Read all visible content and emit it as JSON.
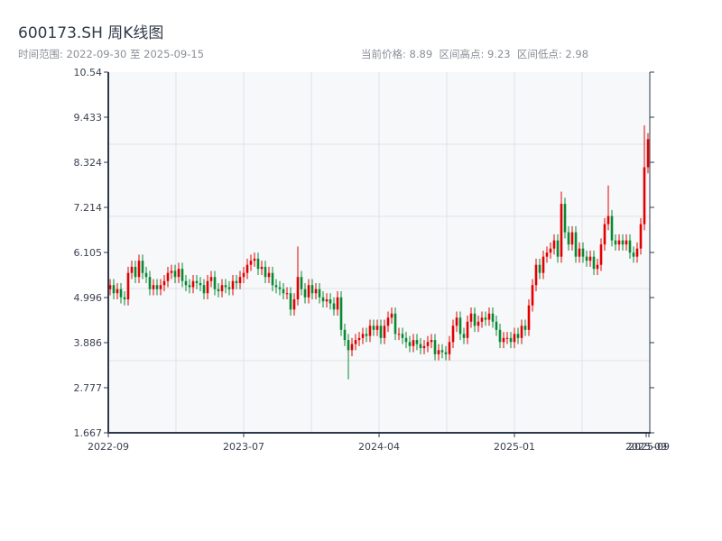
{
  "header": {
    "title": "600173.SH 周K线图",
    "range": "时间范围: 2022-09-30 至 2025-09-15",
    "stats": "当前价格: 8.89  区间高点: 9.23  区间低点: 2.98"
  },
  "colors": {
    "up": "#e00000",
    "down": "#078a33",
    "axis": "#2c3a4b",
    "grid": "#dfe2e7",
    "plot_bg": "#f7f8fa"
  },
  "chart_data": {
    "type": "candlestick",
    "title": "600173.SH 周K线图",
    "ylim": [
      1.667,
      10.54
    ],
    "yticks": [
      "1.667",
      "2.777",
      "3.886",
      "4.996",
      "6.105",
      "7.214",
      "8.324",
      "9.433",
      "10.54"
    ],
    "xticks": [
      "2022-09",
      "2023-07",
      "2024-04",
      "2025-01",
      "2025-09",
      "2025-09"
    ],
    "first_open": 5.2,
    "close": [
      5.3,
      5.1,
      5.2,
      5.0,
      4.95,
      5.6,
      5.75,
      5.5,
      5.9,
      5.6,
      5.5,
      5.2,
      5.3,
      5.2,
      5.3,
      5.4,
      5.6,
      5.65,
      5.5,
      5.7,
      5.4,
      5.3,
      5.25,
      5.4,
      5.35,
      5.3,
      5.1,
      5.4,
      5.5,
      5.2,
      5.15,
      5.3,
      5.25,
      5.2,
      5.4,
      5.35,
      5.5,
      5.6,
      5.8,
      5.9,
      5.95,
      5.7,
      5.75,
      5.5,
      5.6,
      5.3,
      5.25,
      5.2,
      5.1,
      5.1,
      4.7,
      4.95,
      5.5,
      5.2,
      5.0,
      5.3,
      5.1,
      5.2,
      5.0,
      4.9,
      4.95,
      4.85,
      4.7,
      5.0,
      4.2,
      3.95,
      3.7,
      3.85,
      3.95,
      4.0,
      4.1,
      4.05,
      4.3,
      4.2,
      4.3,
      4.0,
      4.3,
      4.5,
      4.6,
      4.1,
      4.1,
      4.0,
      3.9,
      3.8,
      3.95,
      3.85,
      3.75,
      3.8,
      3.9,
      3.95,
      3.6,
      3.7,
      3.65,
      3.6,
      3.9,
      4.3,
      4.5,
      4.1,
      4.0,
      4.4,
      4.6,
      4.3,
      4.4,
      4.5,
      4.45,
      4.6,
      4.4,
      4.2,
      3.9,
      4.0,
      4.0,
      3.9,
      4.1,
      4.0,
      4.3,
      4.2,
      4.8,
      5.3,
      5.8,
      5.6,
      6.0,
      6.1,
      6.2,
      6.4,
      6.0,
      7.3,
      6.6,
      6.3,
      6.6,
      6.0,
      6.2,
      6.0,
      5.9,
      6.0,
      5.7,
      5.8,
      6.3,
      6.8,
      7.0,
      6.4,
      6.3,
      6.4,
      6.3,
      6.4,
      6.1,
      6.0,
      6.2,
      6.8,
      8.2,
      8.89
    ],
    "wick": 0.15,
    "extremes": {
      "66": {
        "low": 2.98
      },
      "52": {
        "high": 6.25
      },
      "125": {
        "high": 7.6
      },
      "138": {
        "high": 7.75
      },
      "148": {
        "high": 9.23
      }
    }
  }
}
